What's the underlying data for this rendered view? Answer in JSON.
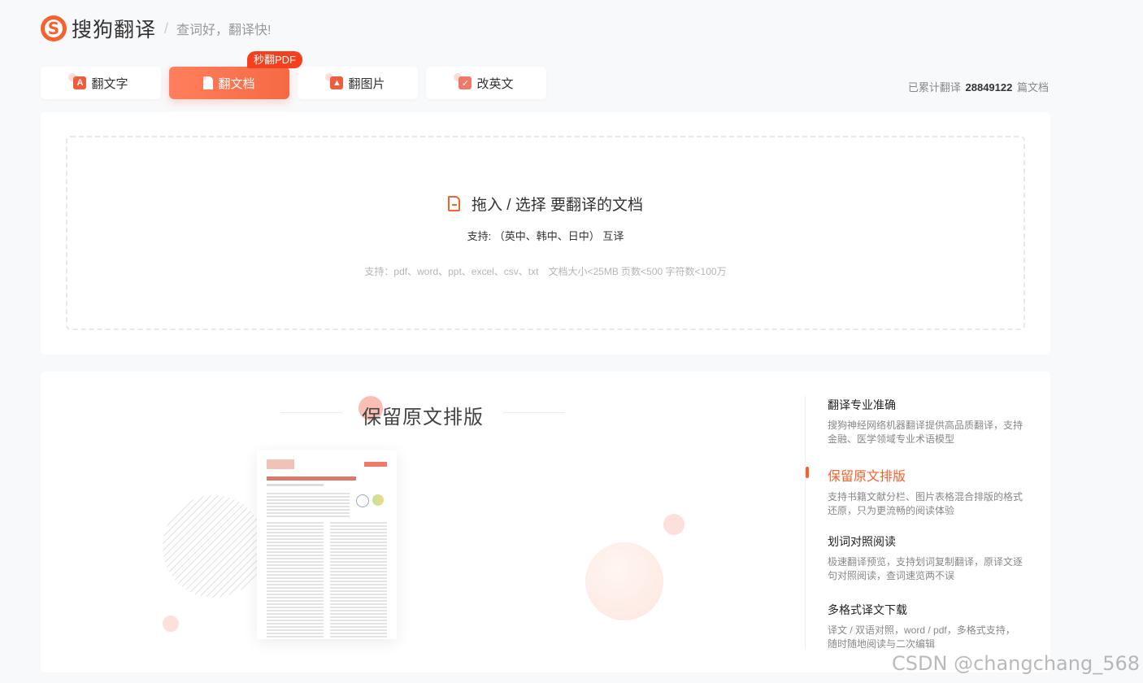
{
  "header": {
    "logo_glyph": "S",
    "logo_text": "搜狗翻译",
    "separator": "/",
    "slogan": "查词好，翻译快!"
  },
  "tabs": [
    {
      "label": "翻文字",
      "icon": "text-translate-icon",
      "active": false
    },
    {
      "label": "翻文档",
      "icon": "document-icon",
      "active": true
    },
    {
      "label": "翻图片",
      "icon": "image-icon",
      "active": false
    },
    {
      "label": "改英文",
      "icon": "english-correct-icon",
      "active": false
    }
  ],
  "badge": "秒翻PDF",
  "counter": {
    "prefix": "已累计翻译",
    "count": "28849122",
    "suffix": "篇文档"
  },
  "upload": {
    "title": "拖入 / 选择 要翻译的文档",
    "languages": "支持: （英中、韩中、日中） 互译",
    "formats": "支持：pdf、word、ppt、excel、csv、txt　文档大小<25MB 页数<500 字符数<100万"
  },
  "feature": {
    "title": "保留原文排版",
    "items": [
      {
        "title": "翻译专业准确",
        "desc": "搜狗神经网络机器翻译提供高品质翻译，支持金融、医学领域专业术语模型",
        "active": false
      },
      {
        "title": "保留原文排版",
        "desc": "支持书籍文献分栏、图片表格混合排版的格式还原，只为更流畅的阅读体验",
        "active": true
      },
      {
        "title": "划词对照阅读",
        "desc": "极速翻译预览，支持划词复制翻译，原译文逐句对照阅读，查词速览两不误",
        "active": false
      },
      {
        "title": "多格式译文下载",
        "desc": "译文 / 双语对照，word / pdf，多格式支持，随时随地阅读与二次编辑",
        "active": false
      }
    ]
  },
  "watermark": "CSDN @changchang_568",
  "colors": {
    "accent": "#f5622d",
    "tab_active_start": "#ff7f5c",
    "tab_active_end": "#f56a45",
    "badge": "#f5401e"
  }
}
